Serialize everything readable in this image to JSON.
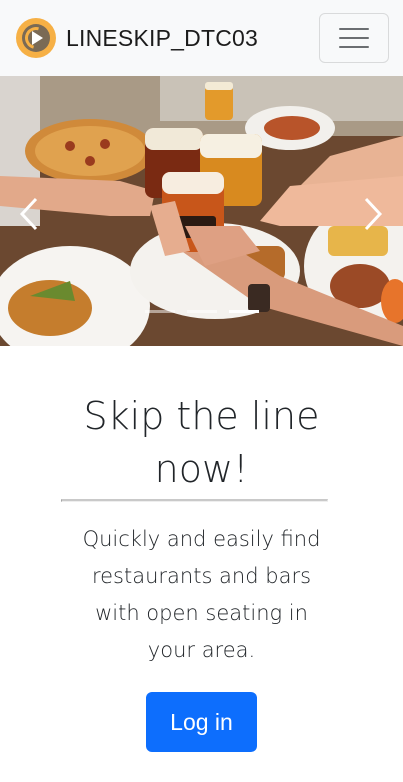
{
  "navbar": {
    "brand_name": "LINESKIP_DTC03",
    "logo_icon": "play-logo-icon",
    "menu_icon": "hamburger-menu-icon"
  },
  "carousel": {
    "image": "food-and-beer-toast-photo",
    "prev_icon": "chevron-left-icon",
    "next_icon": "chevron-right-icon",
    "slide_count": 3,
    "active_slide": 3
  },
  "hero": {
    "heading": "Skip the line now!",
    "lead": "Quickly and easily find restaurants and bars with open seating in your area.",
    "login_label": "Log in"
  },
  "colors": {
    "navbar_bg": "#f8f9fa",
    "primary": "#0d6efd",
    "logo_orange": "#f6b045"
  }
}
